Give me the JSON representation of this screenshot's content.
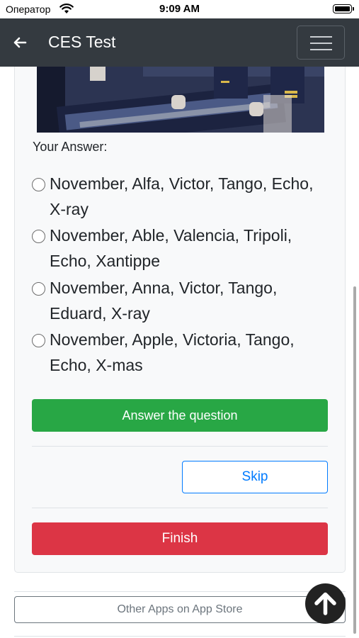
{
  "status_bar": {
    "carrier": "Оператор",
    "time": "9:09 AM"
  },
  "navbar": {
    "title": "CES Test",
    "back_icon": "arrow-left-icon",
    "menu_icon": "hamburger-menu-icon"
  },
  "question": {
    "prompt": "Your Answer:",
    "options": [
      {
        "line1": "November, Alfa, Victor, Tango, Echo,",
        "line2": "X-ray"
      },
      {
        "line1": "November, Able, Valencia, Tripoli,",
        "line2": "Echo, Xantippe"
      },
      {
        "line1": "November, Anna, Victor, Tango,",
        "line2": "Eduard, X-ray"
      },
      {
        "line1": "November, Apple, Victoria, Tango,",
        "line2": "Echo, X-mas"
      }
    ]
  },
  "buttons": {
    "answer": "Answer the question",
    "skip": "Skip",
    "finish": "Finish",
    "other_apps": "Other Apps on App Store"
  },
  "colors": {
    "navbar": "#343a40",
    "success": "#28a745",
    "primary": "#007bff",
    "danger": "#dc3545",
    "secondary": "#6c757d"
  }
}
